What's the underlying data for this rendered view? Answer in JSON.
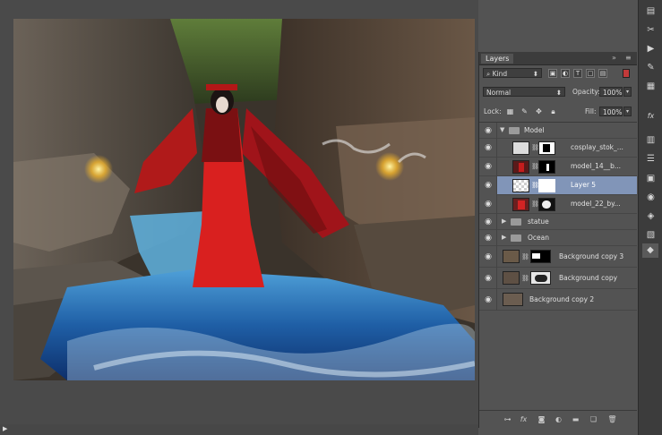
{
  "panel": {
    "tab": "Layers",
    "filter_kind": "Kind",
    "blend_mode": "Normal",
    "opacity_label": "Opacity:",
    "opacity_value": "100%",
    "lock_label": "Lock:",
    "fill_label": "Fill:",
    "fill_value": "100%"
  },
  "layers": [
    {
      "name": "Model",
      "type": "group",
      "expanded": true
    },
    {
      "name": "cosplay_stok_...",
      "type": "layer"
    },
    {
      "name": "model_14__b...",
      "type": "layer"
    },
    {
      "name": "Layer 5",
      "type": "layer",
      "selected": true
    },
    {
      "name": "model_22_by...",
      "type": "layer"
    },
    {
      "name": "statue",
      "type": "group"
    },
    {
      "name": "Ocean",
      "type": "group"
    },
    {
      "name": "Background copy 3",
      "type": "layer"
    },
    {
      "name": "Background copy",
      "type": "layer"
    },
    {
      "name": "Background copy 2",
      "type": "layer"
    }
  ],
  "icons": {
    "eye": "eye-icon",
    "link": "link-icon",
    "fx": "fx-icon",
    "mask": "mask-icon",
    "adjust": "adjustment-icon",
    "folder": "folder-icon",
    "new": "new-layer-icon",
    "trash": "trash-icon"
  },
  "colors": {
    "selection": "#8195b8",
    "panel_bg": "#535353",
    "canvas_bg": "#4a4a4a"
  }
}
